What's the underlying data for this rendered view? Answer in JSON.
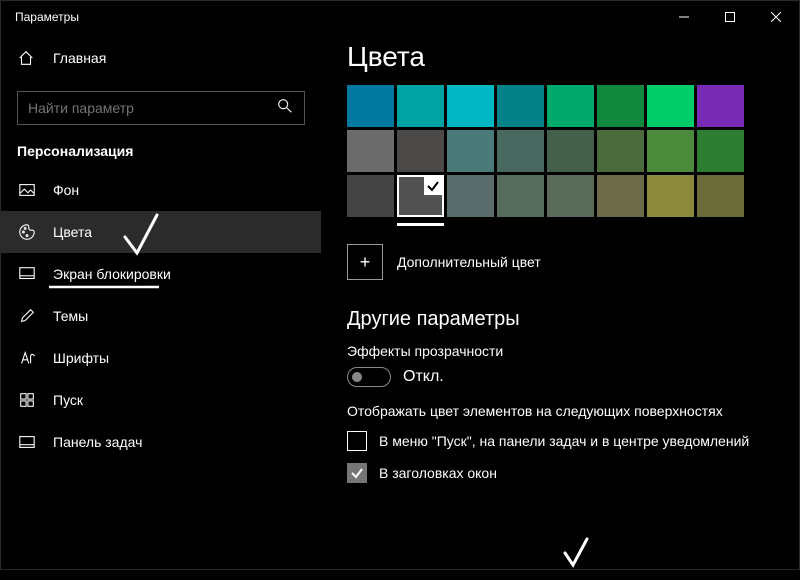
{
  "window": {
    "title": "Параметры"
  },
  "home": {
    "label": "Главная"
  },
  "search": {
    "placeholder": "Найти параметр"
  },
  "category": "Персонализация",
  "nav": [
    {
      "name": "background",
      "label": "Фон"
    },
    {
      "name": "colors",
      "label": "Цвета",
      "active": true
    },
    {
      "name": "lockscreen",
      "label": "Экран блокировки"
    },
    {
      "name": "themes",
      "label": "Темы"
    },
    {
      "name": "fonts",
      "label": "Шрифты"
    },
    {
      "name": "start",
      "label": "Пуск"
    },
    {
      "name": "taskbar",
      "label": "Панель задач"
    }
  ],
  "content": {
    "title": "Цвета",
    "colors_row1": [
      "#0078a0",
      "#00a3a3",
      "#00b7c3",
      "#038387",
      "#00a86b",
      "#10893e",
      "#00cc6a",
      "#7a2bb5"
    ],
    "colors_row2": [
      "#6b6b6b",
      "#4c4a48",
      "#4a7a7a",
      "#486860",
      "#45604a",
      "#4c6b3d",
      "#4b8b3b",
      "#2d7d32"
    ],
    "colors_row3": [
      "#444444",
      "#525252",
      "#5a6b6b",
      "#566b5c",
      "#5a6b5a",
      "#6b6b4a",
      "#8a8a3a",
      "#6b6b3a"
    ],
    "selected_index": {
      "row": 2,
      "col": 1
    },
    "custom_color_label": "Дополнительный цвет",
    "more_params": "Другие параметры",
    "transparency_label": "Эффекты прозрачности",
    "toggle_off": "Откл.",
    "surfaces_label": "Отображать цвет элементов на следующих поверхностях",
    "chk_start": {
      "label": "В меню \"Пуск\", на панели задач и в центре уведомлений",
      "checked": false
    },
    "chk_titlebars": {
      "label": "В заголовках окон",
      "checked": true
    }
  }
}
